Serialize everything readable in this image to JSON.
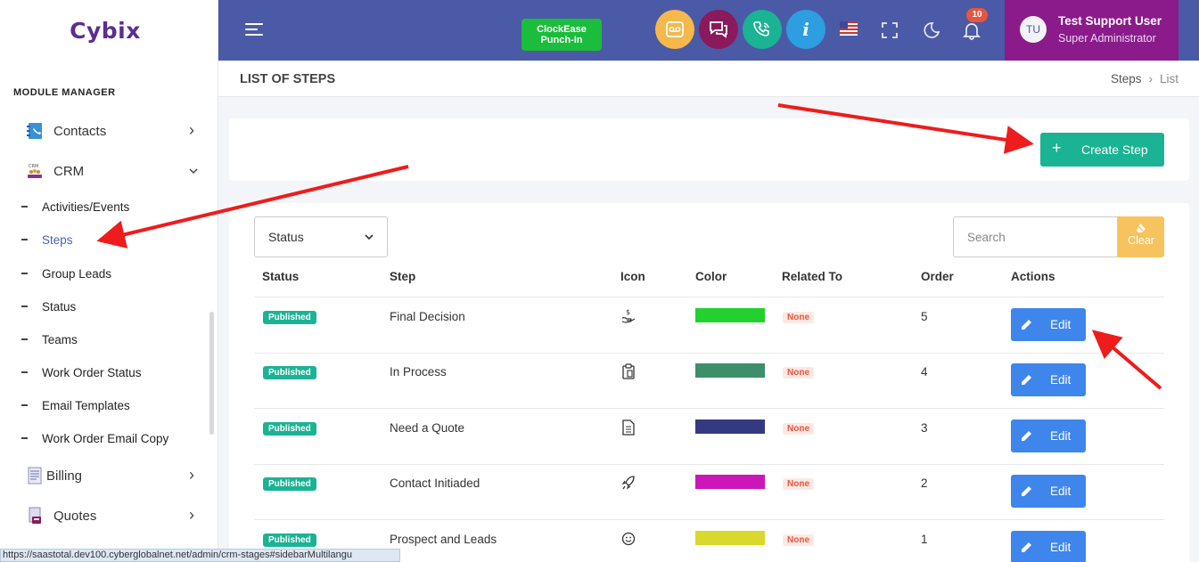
{
  "brand": {
    "name": "Cybix",
    "color": "#5c2d91"
  },
  "sidebar": {
    "section_title": "MODULE MANAGER",
    "items": [
      {
        "label": "Contacts",
        "icon": "contacts-book-icon",
        "chevron": "›"
      },
      {
        "label": "CRM",
        "icon": "crm-icon",
        "chevron": "⌄"
      }
    ],
    "sub_items": [
      {
        "label": "Activities/Events"
      },
      {
        "label": "Steps",
        "active": true
      },
      {
        "label": "Group Leads"
      },
      {
        "label": "Status"
      },
      {
        "label": "Teams"
      },
      {
        "label": "Work Order Status"
      },
      {
        "label": "Email Templates"
      },
      {
        "label": "Work Order Email Copy"
      }
    ],
    "bottom_items": [
      {
        "label": "Billing",
        "icon": "billing-document-icon",
        "chevron": "›"
      },
      {
        "label": "Quotes",
        "icon": "quotes-icon",
        "chevron": "›"
      }
    ]
  },
  "topbar": {
    "clock_label_1": "ClockEase",
    "clock_label_2": "Punch-In",
    "notification_count": "10",
    "user": {
      "initials": "TU",
      "name": "Test Support User",
      "role": "Super Administrator"
    },
    "colors": {
      "bar": "#4a5aa6",
      "user_bg": "#8b1a8b",
      "voicemail": "#f7b84b",
      "chat": "#8b1a5c",
      "phone": "#1ab394",
      "info": "#2d9ee0"
    }
  },
  "page": {
    "title": "LIST OF STEPS",
    "breadcrumb": [
      "Steps",
      "List"
    ],
    "create_button": "Create Step"
  },
  "filters": {
    "status_label": "Status",
    "search_placeholder": "Search",
    "clear_label": "Clear"
  },
  "table": {
    "headers": [
      "Status",
      "Step",
      "Icon",
      "Color",
      "Related To",
      "Order",
      "Actions"
    ],
    "rows": [
      {
        "status": "Published",
        "step": "Final Decision",
        "icon": "hand-money-icon",
        "color": "#22d12e",
        "related": "None",
        "order": "5",
        "action": "Edit"
      },
      {
        "status": "Published",
        "step": "In Process",
        "icon": "clipboard-icon",
        "color": "#3d8f6a",
        "related": "None",
        "order": "4",
        "action": "Edit"
      },
      {
        "status": "Published",
        "step": "Need a Quote",
        "icon": "file-text-icon",
        "color": "#343a80",
        "related": "None",
        "order": "3",
        "action": "Edit"
      },
      {
        "status": "Published",
        "step": "Contact Initiaded",
        "icon": "rocket-icon",
        "color": "#cc16b8",
        "related": "None",
        "order": "2",
        "action": "Edit"
      },
      {
        "status": "Published",
        "step": "Prospect and Leads",
        "icon": "smiley-icon",
        "color": "#d9d82c",
        "related": "None",
        "order": "1",
        "action": "Edit"
      }
    ]
  },
  "statusbar_url": "https://saastotal.dev100.cyberglobalnet.net/admin/crm-stages#sidebarMultilangu"
}
